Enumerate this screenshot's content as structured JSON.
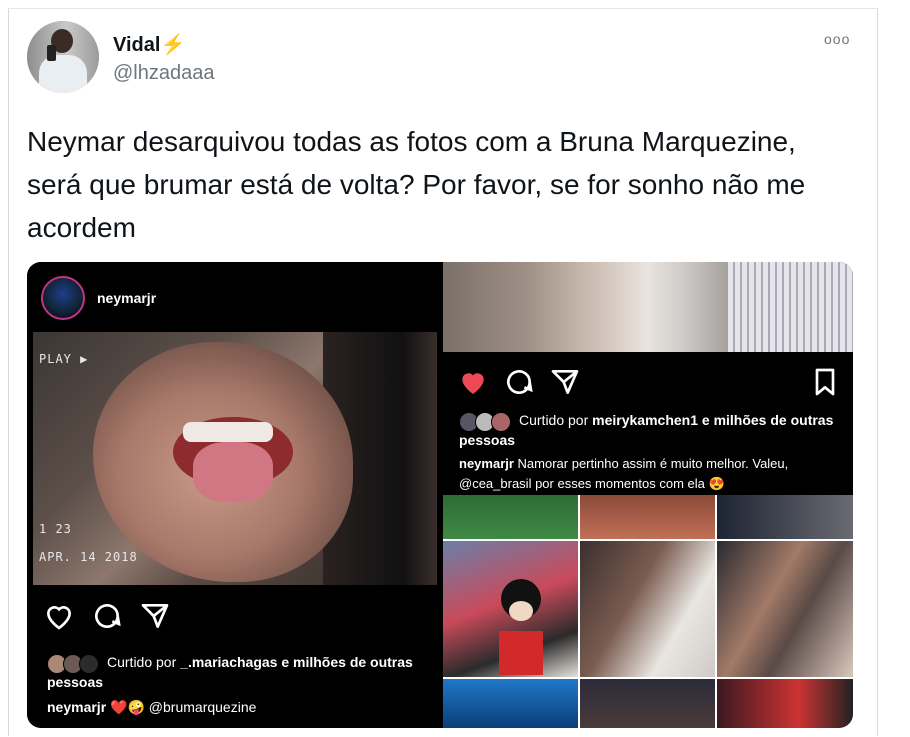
{
  "tweet": {
    "author_name": "Vidal",
    "author_emoji": "⚡",
    "handle": "@lhzadaaa",
    "more_label": "ooo",
    "text": "Neymar desarquivou todas as fotos com a Bruna Marquezine, será que brumar está de volta? Por favor, se for sonho não me acordem"
  },
  "post_left": {
    "username": "neymarjr",
    "vhs_play": "PLAY ▶",
    "vhs_time": "1 23",
    "vhs_date": "APR. 14 2018",
    "liked_by_prefix": "Curtido por",
    "liked_by_user": "_.mariachagas",
    "liked_by_suffix": "e milhões de outras pessoas",
    "caption_user": "neymarjr",
    "caption_text": "❤️🤪 @brumarquezine"
  },
  "post_right": {
    "liked_by_prefix": "Curtido por",
    "liked_by_user": "meirykamchen1",
    "liked_by_suffix": "e milhões de outras pessoas",
    "caption_user": "neymarjr",
    "caption_text": "Namorar pertinho assim é muito melhor. Valeu, @cea_brasil por esses momentos com ela 😍"
  },
  "colors": {
    "like_red": "#ed4956",
    "text_primary": "#0f1419",
    "text_secondary": "#6e767d",
    "bolt": "#f5a623"
  },
  "icons": [
    "heart-icon",
    "comment-icon",
    "share-icon",
    "bookmark-icon",
    "more-icon"
  ]
}
